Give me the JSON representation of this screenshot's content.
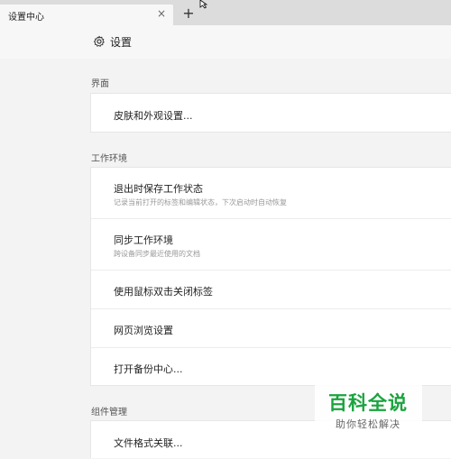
{
  "tab": {
    "title": "设置中心",
    "close": "×",
    "new_tab": "+"
  },
  "header": {
    "title": "设置",
    "icon": "gear-icon"
  },
  "sections": [
    {
      "title": "界面",
      "items": [
        {
          "label": "皮肤和外观设置..."
        }
      ]
    },
    {
      "title": "工作环境",
      "items": [
        {
          "label": "退出时保存工作状态",
          "desc": "记录当前打开的标签和编辑状态，下次启动时自动恢复"
        },
        {
          "label": "同步工作环境",
          "desc": "跨设备同步最近使用的文档"
        },
        {
          "label": "使用鼠标双击关闭标签"
        },
        {
          "label": "网页浏览设置"
        },
        {
          "label": "打开备份中心..."
        }
      ]
    },
    {
      "title": "组件管理",
      "items": [
        {
          "label": "文件格式关联..."
        }
      ]
    }
  ],
  "watermark": {
    "main": "百科全说",
    "sub": "助你轻松解决"
  }
}
